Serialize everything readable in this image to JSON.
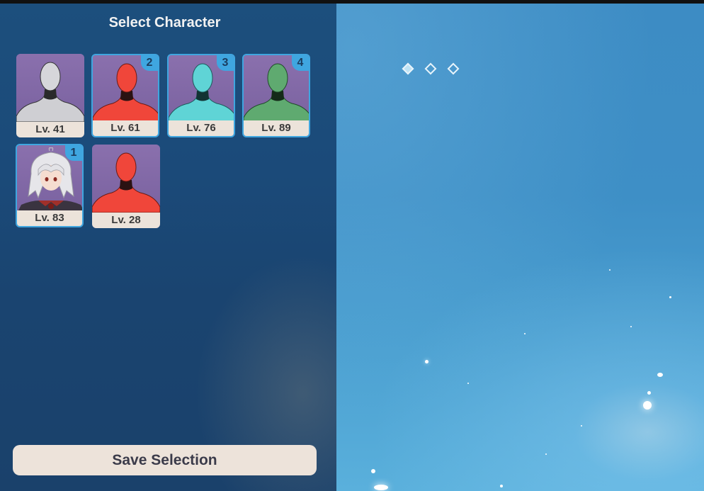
{
  "title": "Select Character",
  "characters": [
    {
      "level": "Lv. 41",
      "badge": "",
      "color": "#d9d9d9",
      "type": "mannequin",
      "selected": false
    },
    {
      "level": "Lv. 61",
      "badge": "2",
      "color": "#f0463a",
      "type": "mannequin",
      "selected": true
    },
    {
      "level": "Lv. 76",
      "badge": "3",
      "color": "#5fd4d6",
      "type": "mannequin",
      "selected": true
    },
    {
      "level": "Lv. 89",
      "badge": "4",
      "color": "#5faa70",
      "type": "mannequin",
      "selected": true
    },
    {
      "level": "Lv. 83",
      "badge": "1",
      "color": "#e0e0e0",
      "type": "anime-portrait",
      "selected": true
    },
    {
      "level": "Lv. 28",
      "badge": "",
      "color": "#f0463a",
      "type": "mannequin",
      "selected": false
    }
  ],
  "save_label": "Save Selection",
  "page_indicator": {
    "count": 3,
    "active": 0
  },
  "colors": {
    "accent": "#3fa6e0",
    "card_bg": "#7d66a0",
    "label_bg": "#ece3da"
  }
}
